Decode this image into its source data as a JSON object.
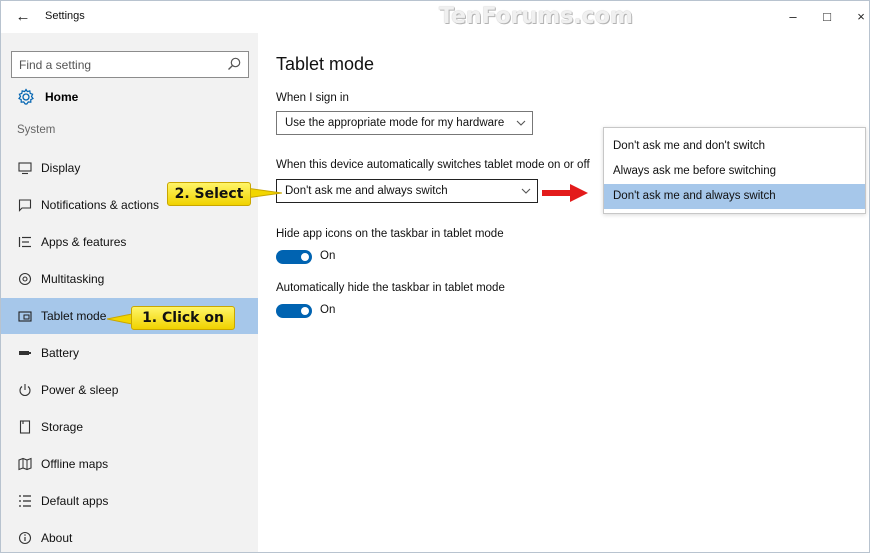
{
  "window": {
    "title": "Settings",
    "watermark": "TenForums.com",
    "back_glyph": "←",
    "minimize_glyph": "–",
    "maximize_glyph": "□",
    "close_glyph": "×"
  },
  "sidebar": {
    "search_placeholder": "Find a setting",
    "home_label": "Home",
    "section_label": "System",
    "items": [
      {
        "label": "Display",
        "icon": "display-icon"
      },
      {
        "label": "Notifications & actions",
        "icon": "notifications-icon"
      },
      {
        "label": "Apps & features",
        "icon": "apps-features-icon"
      },
      {
        "label": "Multitasking",
        "icon": "multitasking-icon"
      },
      {
        "label": "Tablet mode",
        "icon": "tablet-mode-icon",
        "selected": true
      },
      {
        "label": "Battery",
        "icon": "battery-icon"
      },
      {
        "label": "Power & sleep",
        "icon": "power-icon"
      },
      {
        "label": "Storage",
        "icon": "storage-icon"
      },
      {
        "label": "Offline maps",
        "icon": "offline-maps-icon"
      },
      {
        "label": "Default apps",
        "icon": "default-apps-icon"
      },
      {
        "label": "About",
        "icon": "about-icon"
      }
    ]
  },
  "main": {
    "title": "Tablet mode",
    "signin_label": "When I sign in",
    "signin_value": "Use the appropriate mode for my hardware",
    "switch_label": "When this device automatically switches tablet mode on or off",
    "switch_value": "Don't ask me and always switch",
    "hide_icons_label": "Hide app icons on the taskbar in tablet mode",
    "hide_icons_state": "On",
    "auto_hide_label": "Automatically hide the taskbar in tablet mode",
    "auto_hide_state": "On"
  },
  "popup": {
    "options": [
      "Don't ask me and don't switch",
      "Always ask me before switching",
      "Don't ask me and always switch"
    ],
    "selected_index": 2
  },
  "annotations": {
    "select_callout": "2. Select",
    "click_callout": "1. Click on"
  },
  "colors": {
    "accent": "#0063b1",
    "selection": "#a6c7ea",
    "sidebar_bg": "#f2f2f2",
    "callout": "#f7e21e",
    "arrow": "#e31b1b"
  }
}
